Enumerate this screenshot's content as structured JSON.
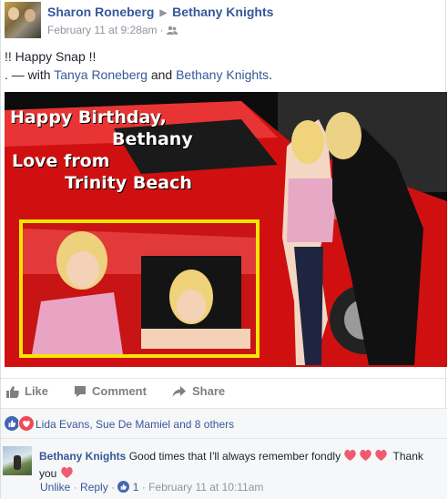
{
  "post": {
    "author": "Sharon Roneberg",
    "target": "Bethany Knights",
    "timestamp": "February 11 at 9:28am",
    "audience_icon": "friends-icon",
    "text_line1": "!! Happy Snap !!",
    "text_line2_prefix": ". — with ",
    "tagged1": "Tanya Roneberg",
    "tagged_and": " and ",
    "tagged2": "Bethany Knights",
    "tagged_suffix": "."
  },
  "photo": {
    "caption_line1": "Happy Birthday,",
    "caption_line2": "Bethany",
    "caption_line3": "Love from",
    "caption_line4": "Trinity Beach"
  },
  "actions": {
    "like": "Like",
    "comment": "Comment",
    "share": "Share"
  },
  "reactions": {
    "summary": "Lida Evans, Sue De Mamiel and 8 others",
    "types": [
      "like",
      "love"
    ]
  },
  "comment": {
    "author": "Bethany Knights",
    "text": "Good times that I'll always remember fondly",
    "text_end": " Thank you",
    "unlike": "Unlike",
    "reply": "Reply",
    "like_count": "1",
    "timestamp": "February 11 at 10:11am",
    "sep": " · "
  },
  "colors": {
    "link": "#365899",
    "meta": "#90949c",
    "like_blue": "#4267b2",
    "love_red": "#ed4956"
  }
}
